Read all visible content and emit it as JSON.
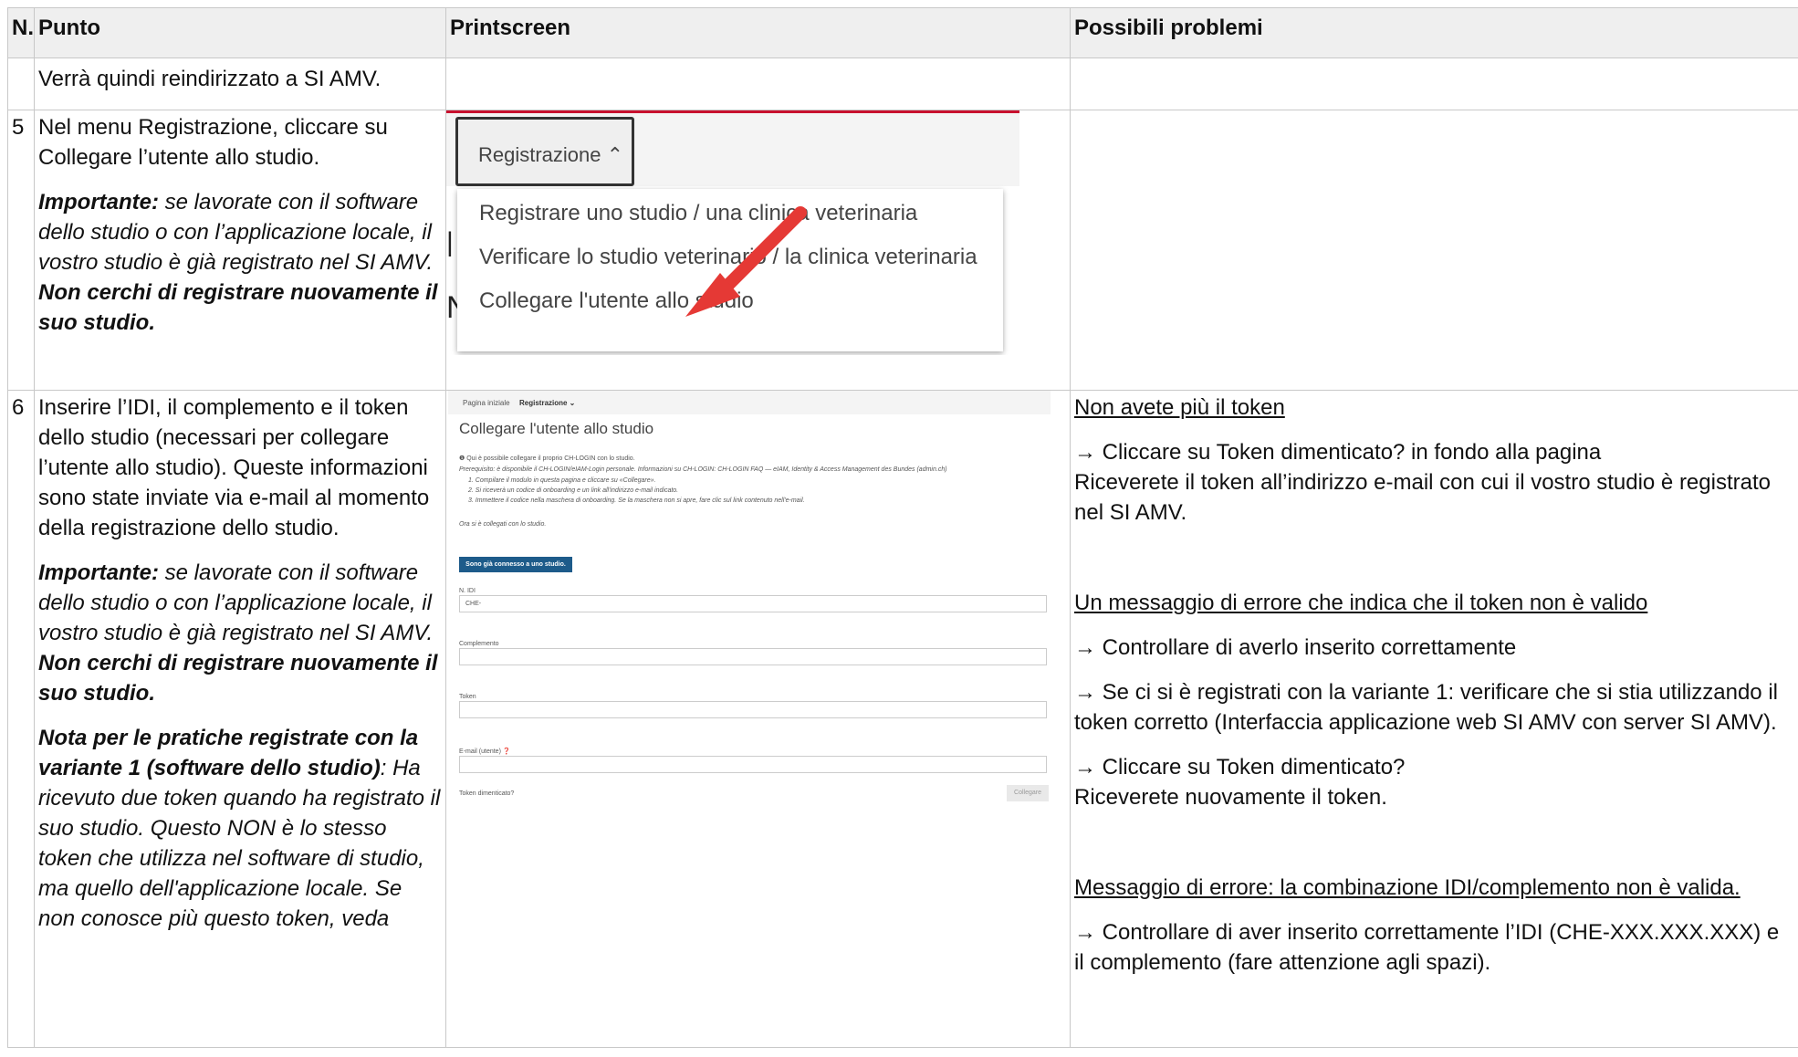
{
  "headers": {
    "num": "N.",
    "step": "Punto",
    "printscreen": "Printscreen",
    "problems": "Possibili problemi"
  },
  "row_prev": {
    "text": "Verrà quindi reindirizzato a SI AMV."
  },
  "row5": {
    "num": "5",
    "line1": "Nel menu Registrazione, cliccare su Collegare l’utente allo studio.",
    "imp_label": "Importante:",
    "imp_text": " se lavorate con il software dello studio o con l’applicazione locale, il vostro studio è già registrato nel SI AMV. ",
    "imp_bold": "Non cerchi di registrare nuovamente il suo studio.",
    "shot": {
      "button": "Registrazione ⌃",
      "items": [
        "Registrare uno studio / una clinica veterinaria",
        "Verificare lo studio veterinario / la clinica veterinaria",
        "Collegare l'utente allo studio"
      ],
      "bg_letter": "N",
      "bg_letter2": "|"
    }
  },
  "row6": {
    "num": "6",
    "line1": "Inserire l’IDI, il complemento e il token dello studio (necessari per collegare l’utente allo studio). Queste informazioni sono state inviate via e-mail al momento della registrazione dello studio.",
    "imp_label": "Importante:",
    "imp_text": " se lavorate con il software dello studio o con l’applicazione locale, il vostro studio è già registrato nel SI AMV. ",
    "imp_bold": "Non cerchi di registrare nuovamente il suo studio.",
    "nota_bold": "Nota per le pratiche registrate con la variante 1 (software dello studio)",
    "nota_text": ": Ha ricevuto due token quando ha registrato il suo studio. Questo NON è lo stesso token che utilizza nel software di studio, ma quello dell'applicazione locale. Se non conosce più questo token, veda",
    "shot": {
      "nav_home": "Pagina iniziale",
      "nav_reg": "Registrazione ⌄",
      "title": "Collegare l'utente allo studio",
      "info1": "❶  Qui è possibile collegare il proprio CH-LOGIN con lo studio.",
      "info2": "Prerequisito: è disponibile il CH-LOGIN/eIAM-Login personale. Informazioni su CH-LOGIN: CH-LOGIN FAQ — eIAM, Identity & Access Management des Bundes (admin.ch)",
      "info3": "1. Compilare il modulo in questa pagina e cliccare su «Collegare».",
      "info4": "2. Si riceverà un codice di onboarding e un link all'indirizzo e-mail indicato.",
      "info5": "3. Immettere il codice nella maschera di onboarding. Se la maschera non si apre, fare clic sul link contenuto nell'e-mail.",
      "info6": "Ora si è collegati con lo studio.",
      "button": "Sono già connesso a uno studio.",
      "lbl_idi": "N. IDI",
      "val_idi": "CHE-",
      "lbl_compl": "Complemento",
      "lbl_token": "Token",
      "lbl_email": "E-mail (utente) ❓",
      "forgot": "Token dimenticato?",
      "collegare": "Collegare"
    },
    "problems": {
      "p1_title": "Non avete più il token",
      "p1_a": "→ Cliccare su Token dimenticato? in fondo alla pagina",
      "p1_b": "Riceverete il token all’indirizzo e-mail con cui il vostro studio è registrato nel SI AMV.",
      "p2_title": "Un messaggio di errore che indica che il token non è valido",
      "p2_a": "→ Controllare di averlo inserito correttamente",
      "p2_b": "→ Se ci si è registrati con la variante 1: verificare che si stia utilizzando il token corretto (Interfaccia applicazione web SI AMV con server SI AMV).",
      "p2_c": "→ Cliccare su Token dimenticato?",
      "p2_d": "Riceverete nuovamente il token.",
      "p3_title": "Messaggio di errore: la combinazione IDI/complemento non è valida.",
      "p3_a": "→ Controllare di aver inserito correttamente l’IDI (CHE-XXX.XXX.XXX) e il complemento (fare attenzione agli spazi)."
    }
  },
  "colors": {
    "header_bg": "#efefef",
    "border": "#c8c8c8",
    "arrow": "#e53935",
    "brand_red": "#c8102e",
    "button_blue": "#1d5b8a"
  }
}
